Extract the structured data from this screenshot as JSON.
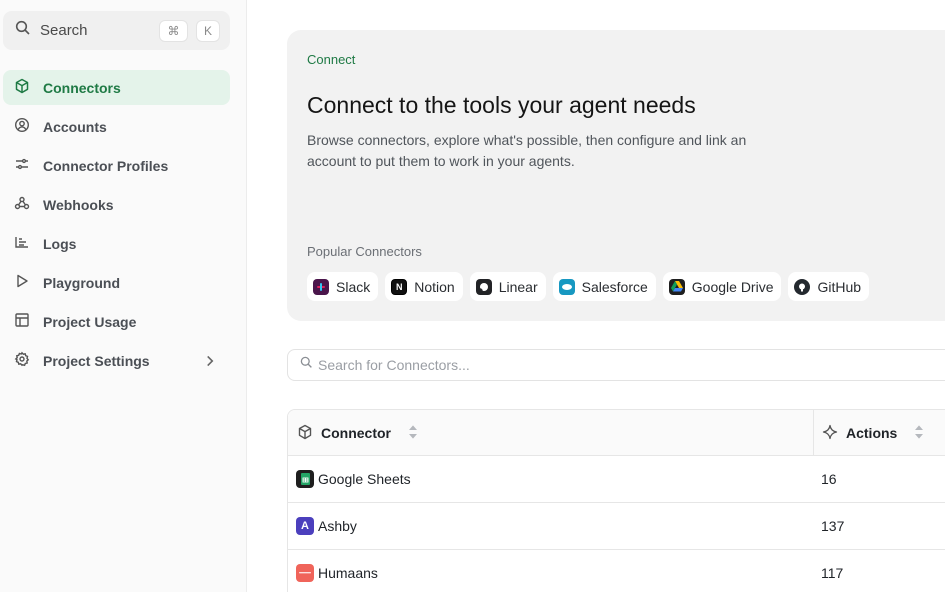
{
  "sidebar": {
    "search": {
      "label": "Search",
      "shortcut_mod": "⌘",
      "shortcut_key": "K"
    },
    "items": [
      {
        "label": "Connectors",
        "icon": "cube-icon",
        "active": true
      },
      {
        "label": "Accounts",
        "icon": "user-circle-icon"
      },
      {
        "label": "Connector Profiles",
        "icon": "sliders-icon"
      },
      {
        "label": "Webhooks",
        "icon": "webhook-icon"
      },
      {
        "label": "Logs",
        "icon": "list-icon"
      },
      {
        "label": "Playground",
        "icon": "play-icon"
      },
      {
        "label": "Project Usage",
        "icon": "table-icon"
      },
      {
        "label": "Project Settings",
        "icon": "gear-icon",
        "has_chevron": true
      }
    ]
  },
  "hero": {
    "eyebrow": "Connect",
    "title": "Connect to the tools your agent needs",
    "subtitle": "Browse connectors, explore what's possible, then configure and link an account to put them to work in your agents.",
    "popular_label": "Popular Connectors",
    "chips": [
      {
        "label": "Slack",
        "color": "#4a154b"
      },
      {
        "label": "Notion",
        "color": "#111111"
      },
      {
        "label": "Linear",
        "color": "#222326"
      },
      {
        "label": "Salesforce",
        "color": "#1798c1"
      },
      {
        "label": "Google Drive",
        "color": "#1f1f1f"
      },
      {
        "label": "GitHub",
        "color": "#24292f"
      }
    ]
  },
  "connector_search": {
    "placeholder": "Search for Connectors..."
  },
  "table": {
    "headers": {
      "connector": "Connector",
      "actions": "Actions"
    },
    "rows": [
      {
        "name": "Google Sheets",
        "actions": "16",
        "color": "#1e1e1e",
        "accent": "#23a566"
      },
      {
        "name": "Ashby",
        "actions": "137",
        "color": "#4b3fbd",
        "accent": "#ffffff"
      },
      {
        "name": "Humaans",
        "actions": "117",
        "color": "#f0645a",
        "accent": "#ffffff"
      }
    ]
  },
  "colors": {
    "accent_green": "#1f7a45",
    "active_bg": "#e4f3ea"
  }
}
